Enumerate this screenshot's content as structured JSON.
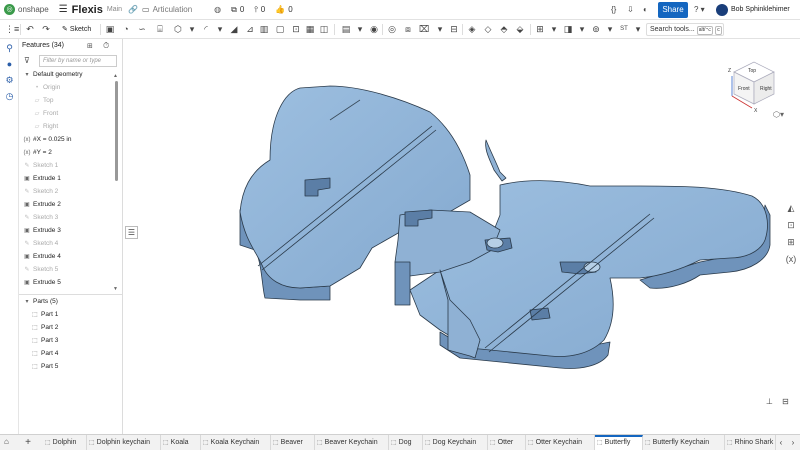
{
  "topbar": {
    "logo_text": "onshape",
    "doc_title": "Flexis",
    "branch": "Main",
    "workspace": "Articulation",
    "versions_count": "0",
    "branches_count": "0",
    "likes_count": "0",
    "share_label": "Share",
    "help_label": "?",
    "user_name": "Bob Sphinklehimer"
  },
  "toolbar": {
    "sketch_label": "Sketch",
    "st_label": "ST",
    "search_label": "Search tools...",
    "search_shortcut_1": "alt/⌥",
    "search_shortcut_2": "c"
  },
  "features": {
    "title": "Features (34)",
    "filter_placeholder": "Filter by name or type",
    "default_geometry": "Default geometry",
    "origin": "Origin",
    "top": "Top",
    "front": "Front",
    "right": "Right",
    "var_x": "#X = 0.025 in",
    "var_y": "#Y = 2",
    "items": [
      {
        "label": "Sketch 1",
        "kind": "sketch"
      },
      {
        "label": "Extrude 1",
        "kind": "extrude"
      },
      {
        "label": "Sketch 2",
        "kind": "sketch"
      },
      {
        "label": "Extrude 2",
        "kind": "extrude"
      },
      {
        "label": "Sketch 3",
        "kind": "sketch"
      },
      {
        "label": "Extrude 3",
        "kind": "extrude"
      },
      {
        "label": "Sketch 4",
        "kind": "sketch"
      },
      {
        "label": "Extrude 4",
        "kind": "extrude"
      },
      {
        "label": "Sketch 5",
        "kind": "sketch"
      },
      {
        "label": "Extrude 5",
        "kind": "extrude"
      }
    ],
    "parts_header": "Parts (5)",
    "parts": [
      "Part 1",
      "Part 2",
      "Part 3",
      "Part 4",
      "Part 5"
    ]
  },
  "viewcube": {
    "top": "Top",
    "front": "Front",
    "right": "Right",
    "axis_x": "X",
    "axis_z": "Z"
  },
  "tabs": [
    {
      "label": "Dolphin",
      "active": false
    },
    {
      "label": "Dolphin keychain",
      "active": false
    },
    {
      "label": "Koala",
      "active": false
    },
    {
      "label": "Koala Keychain",
      "active": false
    },
    {
      "label": "Beaver",
      "active": false
    },
    {
      "label": "Beaver Keychain",
      "active": false
    },
    {
      "label": "Dog",
      "active": false
    },
    {
      "label": "Dog Keychain",
      "active": false
    },
    {
      "label": "Otter",
      "active": false
    },
    {
      "label": "Otter Keychain",
      "active": false
    },
    {
      "label": "Butterfly",
      "active": true
    },
    {
      "label": "Butterfly Keychain",
      "active": false
    },
    {
      "label": "Rhino Shark",
      "active": false
    }
  ],
  "colors": {
    "accent": "#1466c0",
    "part_fill": "#8fb1d4",
    "part_side": "#6f93bb",
    "logo_green": "#3a9a4a"
  }
}
